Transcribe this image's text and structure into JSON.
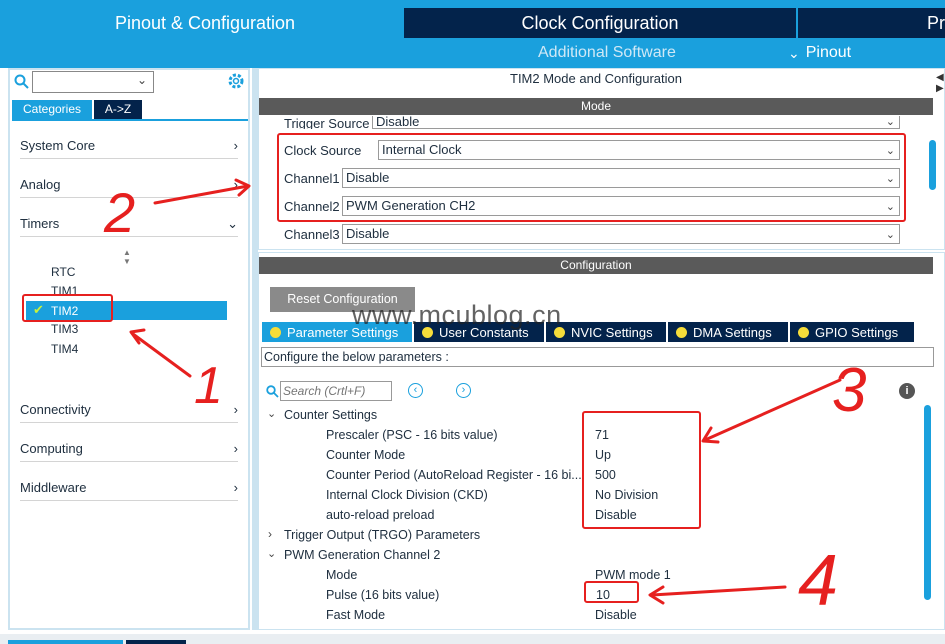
{
  "header": {
    "tabs": [
      {
        "label": "Pinout & Configuration"
      },
      {
        "label": "Clock Configuration"
      },
      {
        "label": "Pr"
      }
    ],
    "sub_additional": "Additional Software",
    "sub_pinout": "Pinout"
  },
  "left": {
    "cat_tabs": [
      "Categories",
      "A->Z"
    ],
    "categories": [
      "System Core",
      "Analog",
      "Timers",
      "Connectivity",
      "Computing",
      "Middleware"
    ],
    "timers": [
      "RTC",
      "TIM1",
      "TIM2",
      "TIM3",
      "TIM4"
    ]
  },
  "mode": {
    "title": "TIM2 Mode and Configuration",
    "band": "Mode",
    "rows": [
      {
        "label": "Trigger Source",
        "value": "Disable"
      },
      {
        "label": "Clock Source",
        "value": "Internal Clock"
      },
      {
        "label": "Channel1",
        "value": "Disable"
      },
      {
        "label": "Channel2",
        "value": "PWM Generation CH2"
      },
      {
        "label": "Channel3",
        "value": "Disable"
      }
    ]
  },
  "config": {
    "band": "Configuration",
    "reset_button": "Reset Configuration",
    "tabs": [
      "Parameter Settings",
      "User Constants",
      "NVIC Settings",
      "DMA Settings",
      "GPIO Settings"
    ],
    "instruction": "Configure the below parameters :",
    "search_placeholder": "Search (Crtl+F)",
    "groups": [
      {
        "name": "Counter Settings"
      },
      {
        "name": "Trigger Output (TRGO) Parameters"
      },
      {
        "name": "PWM Generation Channel 2"
      }
    ],
    "counter_params": [
      {
        "name": "Prescaler (PSC - 16 bits value)",
        "value": "71"
      },
      {
        "name": "Counter Mode",
        "value": "Up"
      },
      {
        "name": "Counter Period (AutoReload Register - 16 bi...",
        "value": "500"
      },
      {
        "name": "Internal Clock Division (CKD)",
        "value": "No Division"
      },
      {
        "name": "auto-reload preload",
        "value": "Disable"
      }
    ],
    "pwm_params": [
      {
        "name": "Mode",
        "value": "PWM mode 1"
      },
      {
        "name": "Pulse (16 bits value)",
        "value": "10"
      },
      {
        "name": "Fast Mode",
        "value": "Disable"
      }
    ]
  },
  "watermark": "www.mcublog.cn",
  "annotations": [
    "1",
    "2",
    "3",
    "4"
  ],
  "colors": {
    "accent": "#1aa0dd",
    "dark": "#03234b",
    "annotation": "#e6201f"
  }
}
